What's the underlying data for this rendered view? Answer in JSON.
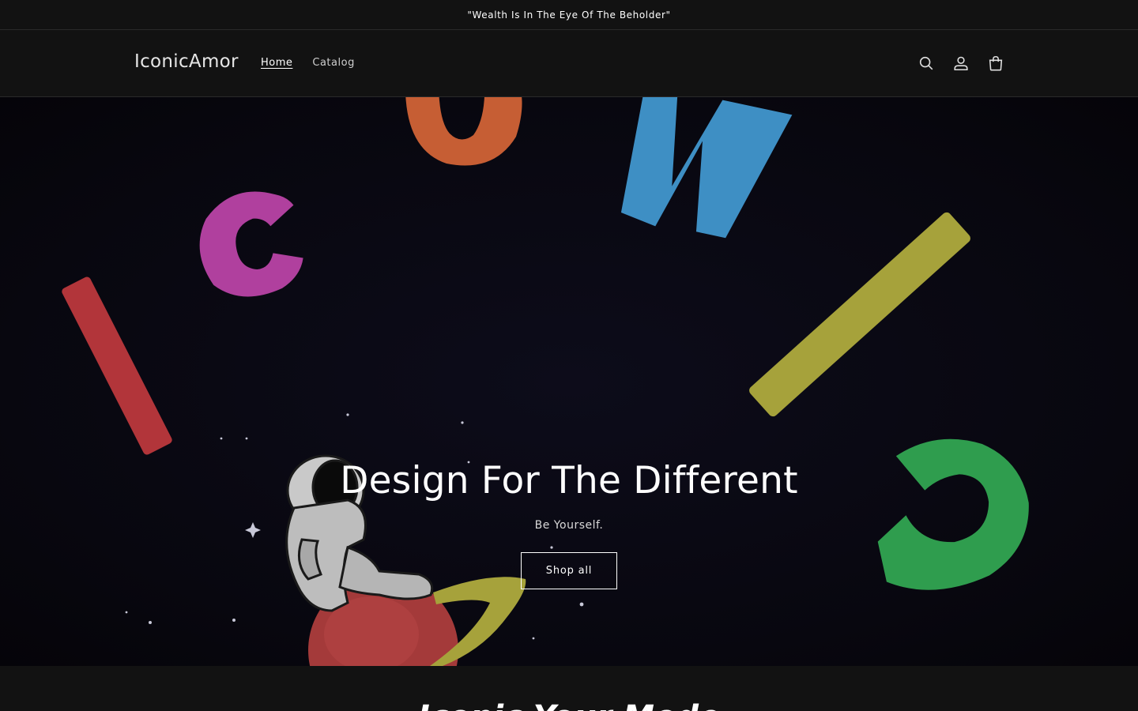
{
  "announcement": {
    "text": "\"Wealth Is In The Eye Of The Beholder\""
  },
  "header": {
    "logo": "IconicAmor",
    "nav": [
      {
        "label": "Home",
        "active": true
      },
      {
        "label": "Catalog",
        "active": false
      }
    ],
    "icons": [
      "search-icon",
      "account-icon",
      "cart-icon"
    ]
  },
  "hero": {
    "title": "Design For The Different",
    "subtitle": "Be Yourself.",
    "button_label": "Shop all"
  },
  "next_section": {
    "heading": "Iconic Your Mode"
  },
  "colors": {
    "background": "#121212",
    "hero_bg": "#08070f",
    "letter_magenta": "#b0409e",
    "letter_orange": "#c65e34",
    "letter_blue": "#3e8fc4",
    "letter_red": "#b2353a",
    "letter_yellow": "#a6a23b",
    "letter_green": "#2f9d4e"
  }
}
